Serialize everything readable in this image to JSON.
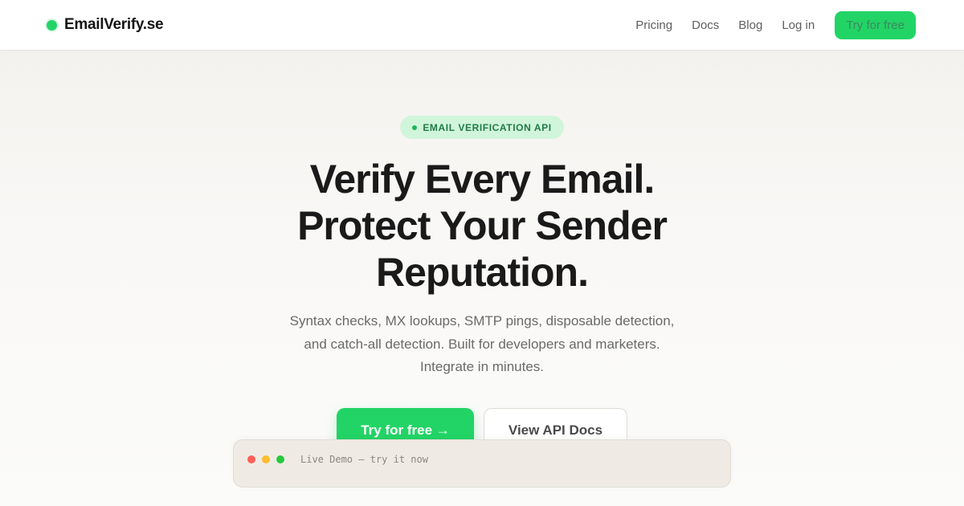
{
  "brand": {
    "name": "EmailVerify.se",
    "accent_color": "#22d466"
  },
  "nav": {
    "links": [
      "Pricing",
      "Docs",
      "Blog",
      "Log in"
    ],
    "cta_label": "Try for free"
  },
  "hero": {
    "badge": "EMAIL VERIFICATION API",
    "headline": [
      "Verify Every Email.",
      "Protect Your Sender",
      "Reputation."
    ],
    "subtext": [
      "Syntax checks, MX lookups, SMTP pings, disposable detection,",
      "and catch-all detection. Built for developers and marketers.",
      "Integrate in minutes."
    ],
    "primary_cta": "Try for free →",
    "secondary_cta": "View API Docs"
  },
  "demo": {
    "title": "Live Demo — try it now",
    "window_buttons": [
      "close",
      "minimize",
      "maximize"
    ]
  }
}
